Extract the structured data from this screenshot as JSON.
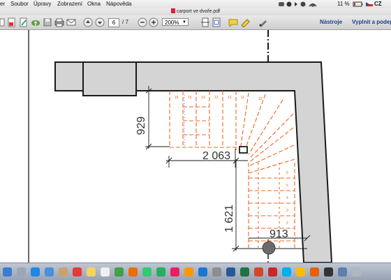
{
  "menubar": {
    "items": [
      "er",
      "Soubor",
      "Úpravy",
      "Zobrazení",
      "Okna",
      "Nápověda"
    ],
    "battery": "11 %",
    "language_code": "CZ"
  },
  "window": {
    "title": "carport ve dvoře.pdf"
  },
  "toolbar": {
    "page_current": "6",
    "page_total": "/ 7",
    "zoom": "200%",
    "tools_label": "Nástroje",
    "fill_sign_label": "Vyplnit a podep"
  },
  "drawing": {
    "dim_upper": "929",
    "dim_width": "2 063",
    "dim_lower": "1 621",
    "dim_bottom": "913",
    "step_numbers_upper": [
      "16",
      "15",
      "14",
      "13",
      "12",
      "11",
      "10"
    ],
    "step_numbers_lower": [
      "6",
      "5",
      "4",
      "3",
      "2",
      "1"
    ],
    "colors": {
      "wall": "#d4d4d4",
      "stair": "#f26522",
      "line": "#1a1a1a"
    }
  },
  "dock": {
    "icon_names": [
      "finder-icon",
      "launchpad-icon",
      "safari-icon",
      "mail-icon",
      "contacts-icon",
      "calendar-icon",
      "notes-icon",
      "reminders-icon",
      "maps-icon",
      "photos-icon",
      "messages-icon",
      "facetime-icon",
      "itunes-icon",
      "ibooks-icon",
      "appstore-icon",
      "preferences-icon",
      "word-icon",
      "excel-icon",
      "powerpoint-icon",
      "acrobat-icon",
      "skype-icon",
      "chrome-icon",
      "firefox-icon",
      "terminal-icon",
      "preview-icon",
      "trash-icon"
    ]
  }
}
